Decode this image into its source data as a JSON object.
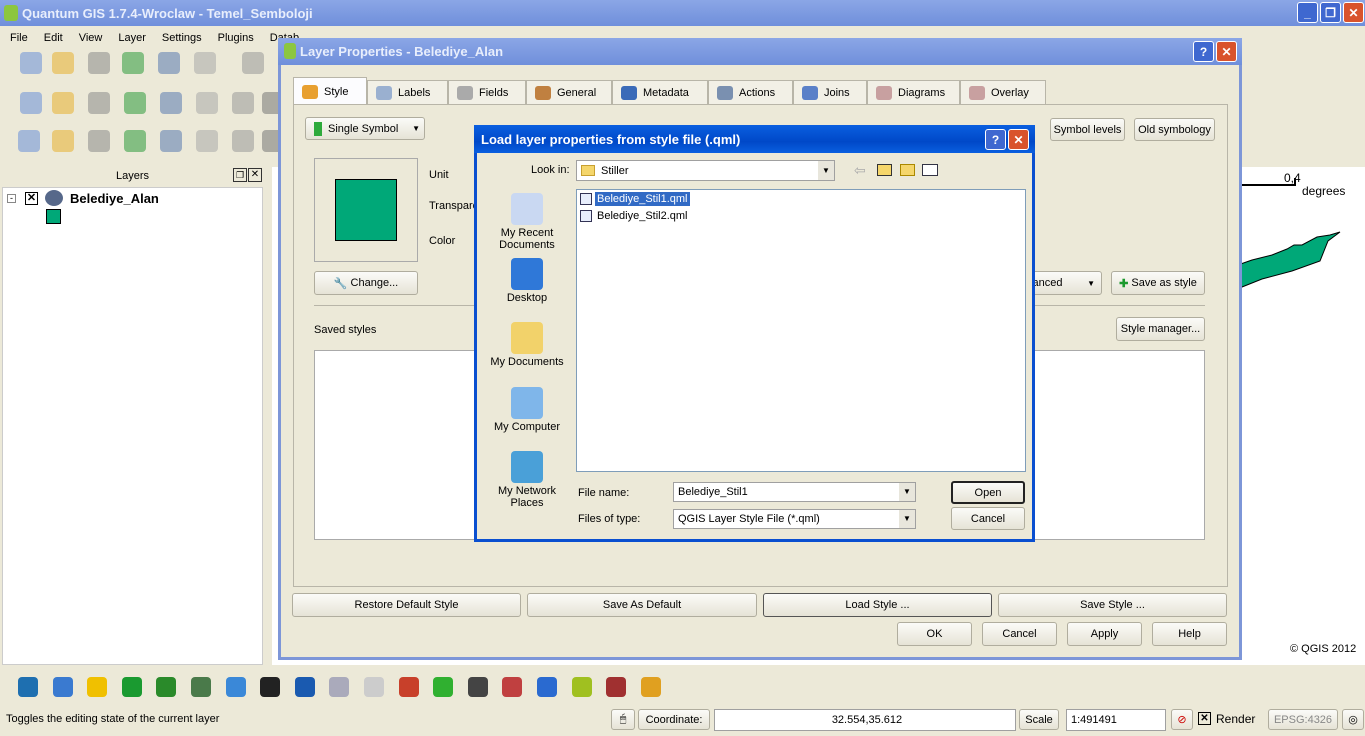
{
  "app": {
    "title": "Quantum GIS 1.7.4-Wroclaw - Temel_Semboloji"
  },
  "menu": [
    "File",
    "Edit",
    "View",
    "Layer",
    "Settings",
    "Plugins",
    "Datab"
  ],
  "layers_panel": {
    "title": "Layers",
    "layer_name": "Belediye_Alan",
    "symbol_color": "#00a878"
  },
  "map": {
    "scale_value": "0,4",
    "scale_unit": "degrees",
    "copyright": "© QGIS 2012",
    "fill_color": "#00a878"
  },
  "status": {
    "message": "Toggles the editing state of the current layer",
    "coordinate_label": "Coordinate:",
    "coordinate": "32.554,35.612",
    "scale_label": "Scale",
    "scale": "1:491491",
    "render_label": "Render",
    "crs": "EPSG:4326"
  },
  "layer_props": {
    "title": "Layer Properties - Belediye_Alan",
    "tabs": [
      "Style",
      "Labels",
      "Fields",
      "General",
      "Metadata",
      "Actions",
      "Joins",
      "Diagrams",
      "Overlay"
    ],
    "renderer": "Single Symbol",
    "symbol_levels": "Symbol levels",
    "old_symbology": "Old symbology",
    "unit_label": "Unit",
    "transparency_label": "Transpare",
    "color_label": "Color",
    "change": "Change...",
    "advanced": "vanced",
    "save_as_style": "Save as style",
    "saved_styles": "Saved styles",
    "style_manager": "Style manager...",
    "bottom": [
      "Restore Default Style",
      "Save As Default",
      "Load Style ...",
      "Save Style ..."
    ],
    "ok": "OK",
    "cancel": "Cancel",
    "apply": "Apply",
    "help": "Help"
  },
  "file_dialog": {
    "title": "Load layer properties from style file (.qml)",
    "look_in_label": "Look in:",
    "look_in": "Stiller",
    "places": [
      "My Recent Documents",
      "Desktop",
      "My Documents",
      "My Computer",
      "My Network Places"
    ],
    "files": [
      {
        "name": "Belediye_Stil1.qml",
        "selected": true
      },
      {
        "name": "Belediye_Stil2.qml",
        "selected": false
      }
    ],
    "file_name_label": "File name:",
    "file_name": "Belediye_Stil1",
    "file_type_label": "Files of type:",
    "file_type": "QGIS Layer Style File (*.qml)",
    "open": "Open",
    "cancel": "Cancel"
  }
}
